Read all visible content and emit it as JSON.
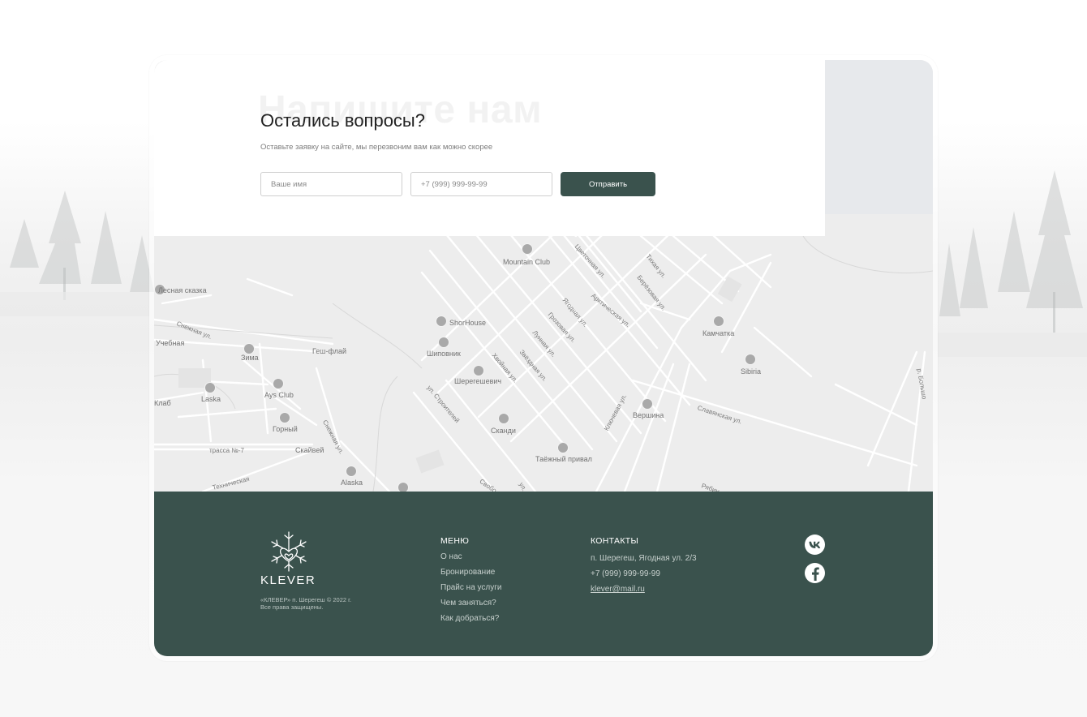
{
  "form": {
    "ghost_title": "Напишите нам",
    "title": "Остались вопросы?",
    "subtitle": "Оставьте заявку на сайте, мы перезвоним вам как можно скорее",
    "name_placeholder": "Ваше имя",
    "phone_placeholder": "+7 (999) 999-99-99",
    "submit_label": "Отправить"
  },
  "map": {
    "places": [
      "Mountain Club",
      "ShorHouse",
      "Шиповник",
      "Шерегешевич",
      "Сканди",
      "Таёжный привал",
      "Вершина",
      "Камчатка",
      "Sibiria",
      "Лесная сказка",
      "Учебная",
      "Зима",
      "Геш-флай",
      "Ays Club",
      "Laska",
      "Клаб",
      "Горный",
      "Скайвей",
      "Alaska"
    ],
    "streets": [
      "Снежная ул.",
      "Снежная ул.",
      "трасса №-7",
      "Цветочная ул.",
      "Тихая ул.",
      "Берёзовая ул.",
      "Ягодная ул.",
      "Арктическая ул.",
      "Грозовая ул.",
      "Лунная ул.",
      "Звёздная ул.",
      "Хвойная ул.",
      "ул. Строителей",
      "Ключевая ул.",
      "Славянская ул.",
      "Свобо",
      "Рябин",
      "р. Большо",
      "Техническая",
      "ул."
    ]
  },
  "footer": {
    "logo_text": "KLEVER",
    "copyright_line1": "«КЛЕВЕР» п. Шерегеш © 2022 г.",
    "copyright_line2": "Все права защищены.",
    "menu_title": "МЕНЮ",
    "menu": [
      "О нас",
      "Бронирование",
      "Прайс на услуги",
      "Чем заняться?",
      "Как добраться?"
    ],
    "contacts_title": "КОНТАКТЫ",
    "address": "п. Шерегеш, Ягодная ул. 2/3",
    "phone": "+7 (999) 999-99-99",
    "email": "klever@mail.ru",
    "social": [
      "vk-icon",
      "facebook-icon"
    ]
  },
  "colors": {
    "accent": "#3a524d",
    "footer_bg": "#3a524d",
    "map_bg": "#ededed",
    "pin": "#9a9a9a"
  }
}
